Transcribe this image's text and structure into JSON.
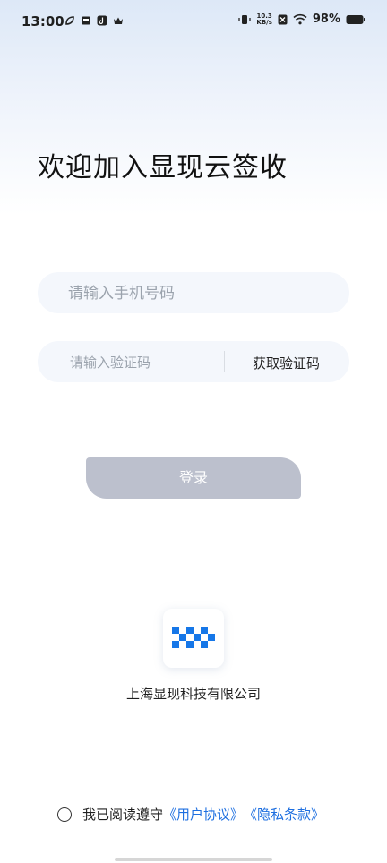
{
  "status_bar": {
    "time": "13:00",
    "net_speed_value": "10.3",
    "net_speed_unit": "KB/s",
    "battery": "98%"
  },
  "page": {
    "title": "欢迎加入显现云签收"
  },
  "form": {
    "phone_placeholder": "请输入手机号码",
    "code_placeholder": "请输入验证码",
    "get_code_label": "获取验证码",
    "login_label": "登录"
  },
  "footer": {
    "company": "上海显现科技有限公司",
    "agree_prefix": "我已阅读遵守",
    "user_agreement": "《用户协议》",
    "privacy_policy": "《隐私条款》"
  },
  "colors": {
    "link": "#1e6fe0",
    "login_button": "#bcc0cd",
    "logo_blue": "#1677e8"
  }
}
